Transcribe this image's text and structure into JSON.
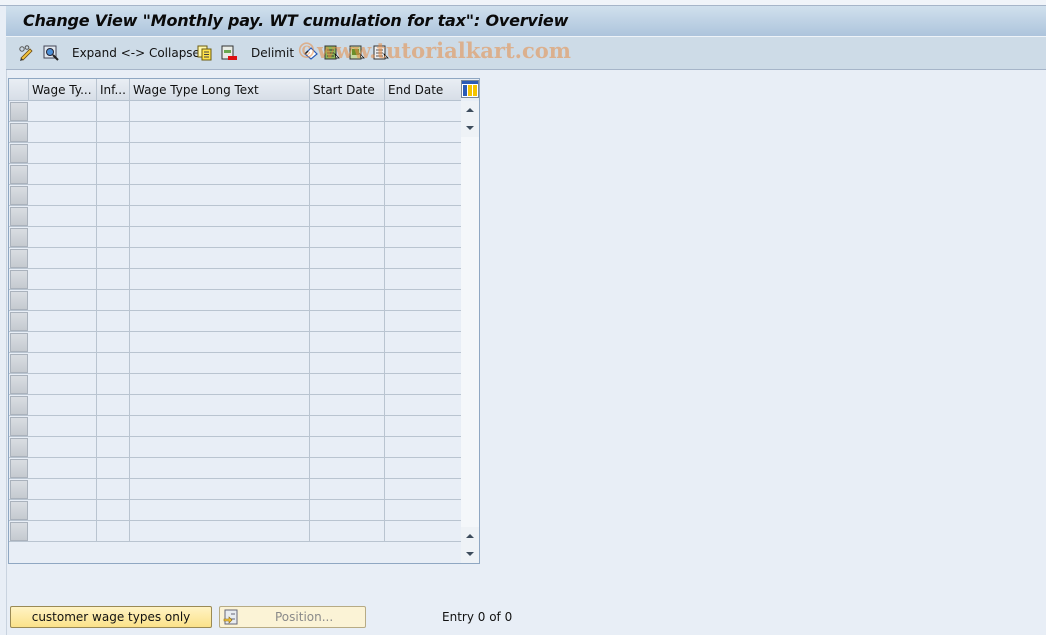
{
  "title": "Change View \"Monthly pay. WT cumulation for tax\": Overview",
  "toolbar": {
    "items": [
      {
        "icon": "edit-glasses-pencil-icon"
      },
      {
        "icon": "detail-view-icon"
      },
      {
        "label": "Expand <-> Collapse"
      },
      {
        "icon": "copy-icon"
      },
      {
        "icon": "delete-row-icon"
      },
      {
        "label": "Delimit"
      },
      {
        "icon": "undo-change-icon"
      },
      {
        "icon": "select-all-icon"
      },
      {
        "icon": "select-block-icon"
      },
      {
        "icon": "deselect-all-icon"
      }
    ]
  },
  "watermark": "©www.tutorialkart.com",
  "table": {
    "columns": [
      "Wage Ty...",
      "Inf...",
      "Wage Type Long Text",
      "Start Date",
      "End Date"
    ],
    "row_count": 21,
    "rows": []
  },
  "bottom": {
    "customer_button": "customer wage types only",
    "position_button": "Position...",
    "entry_info": "Entry 0 of 0"
  },
  "colors": {
    "title_gradient_top": "#d0e0ed",
    "title_gradient_bottom": "#adc4dc",
    "toolbar_bg": "#cddbe7",
    "content_bg": "#e8eef6",
    "button_yellow": "#fbe28a"
  }
}
